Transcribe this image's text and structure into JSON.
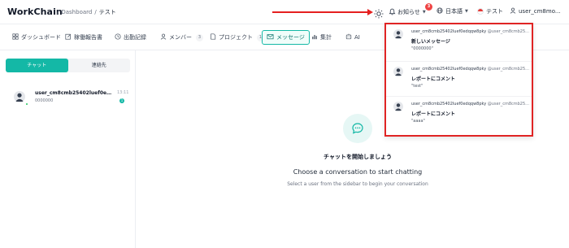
{
  "header": {
    "brand": "WorkChain",
    "breadcrumb": [
      "Dashboard",
      "テスト"
    ],
    "notifications_label": "お知らせ",
    "notifications_count": "3",
    "language_label": "日本語",
    "workspace_label": "テスト",
    "user_label": "user_cm8mo..."
  },
  "tabs": [
    {
      "label": "ダッシュボード",
      "icon": "grid-icon"
    },
    {
      "label": "稼働報告書",
      "icon": "edit-icon"
    },
    {
      "label": "出勤記録",
      "icon": "clock-icon"
    },
    {
      "label": "メンバー",
      "icon": "user-icon",
      "count": "3"
    },
    {
      "label": "プロジェクト",
      "icon": "document-icon",
      "count": "1"
    },
    {
      "label": "メッセージ",
      "icon": "mail-icon",
      "active": true
    },
    {
      "label": "集計",
      "icon": "bar-chart-icon"
    },
    {
      "label": "AI",
      "icon": "ai-icon"
    }
  ],
  "sidebar": {
    "segments": [
      "チャット",
      "連絡先"
    ],
    "conversation": {
      "name": "user_cm8cmb25402luef0edqq...",
      "time": "13:11",
      "preview": "0000000",
      "unread": "1"
    }
  },
  "main": {
    "empty_title": "チャットを開始しましょう",
    "empty_subtitle": "Choose a conversation to start chatting",
    "empty_hint": "Select a user from the sidebar to begin your conversation"
  },
  "notifications": [
    {
      "from": "user_cm8cmb25402luef0edqqw8pky",
      "mention": "@user_cm8cmb25...",
      "title": "新しいメッセージ",
      "body": "\"0000000\""
    },
    {
      "from": "user_cm8cmb25402luef0edqqw8pky",
      "mention": "@user_cm8cmb25...",
      "title": "レポートにコメント",
      "body": "\"test\""
    },
    {
      "from": "user_cm8cmb25402luef0edqqw8pky",
      "mention": "@user_cm8cmb25...",
      "title": "レポートにコメント",
      "body": "\"aaaa\""
    }
  ],
  "colors": {
    "accent": "#14b8a6",
    "badge": "#ef4444",
    "highlight_border": "#e02424"
  }
}
